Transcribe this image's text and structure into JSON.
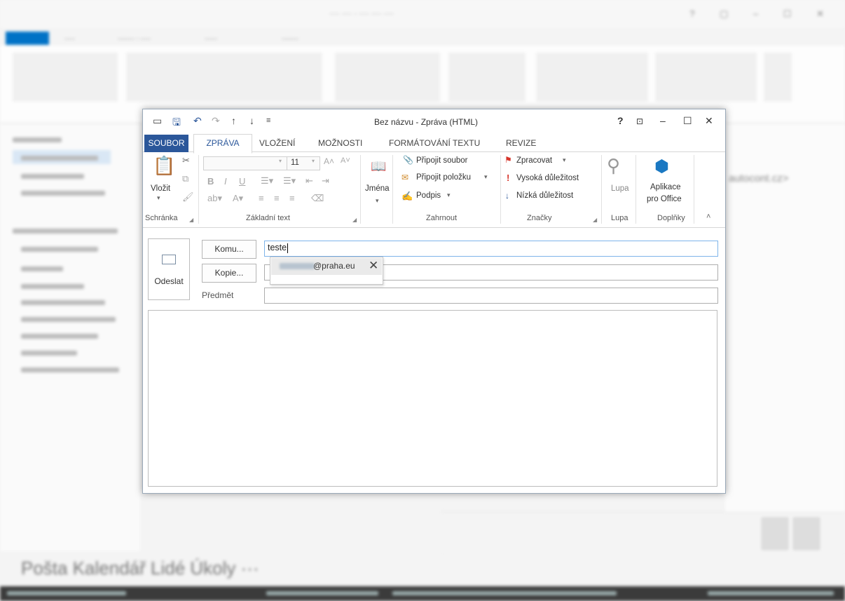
{
  "window": {
    "title": "Bez názvu - Zpráva (HTML)",
    "help": "?",
    "controls": [
      "–",
      "☐",
      "✕"
    ]
  },
  "menu": {
    "file": "SOUBOR",
    "tabs": [
      "ZPRÁVA",
      "VLOŽENÍ",
      "MOŽNOSTI",
      "FORMÁTOVÁNÍ TEXTU",
      "REVIZE"
    ],
    "active": "ZPRÁVA"
  },
  "ribbon": {
    "clipboard": {
      "paste": "Vložit",
      "label": "Schránka"
    },
    "basic_text": {
      "font_size": "11",
      "label": "Základní text"
    },
    "names": {
      "label": "Jména"
    },
    "include": {
      "attach_file": "Připojit soubor",
      "attach_item": "Připojit položku",
      "signature": "Podpis",
      "label": "Zahrnout"
    },
    "tags": {
      "follow_up": "Zpracovat",
      "high": "Vysoká důležitost",
      "low": "Nízká důležitost",
      "label": "Značky"
    },
    "zoom": {
      "button": "Lupa",
      "label": "Lupa"
    },
    "addins": {
      "button_line1": "Aplikace",
      "button_line2": "pro Office",
      "label": "Doplňky"
    }
  },
  "compose": {
    "send": "Odeslat",
    "to_btn": "Komu...",
    "cc_btn": "Kopie...",
    "subject_label": "Předmět",
    "to_value": "teste",
    "autocomplete": {
      "email_suffix": "@praha.eu"
    }
  },
  "background": {
    "email_hint": "autocont.cz>",
    "nav": "Pošta  Kalendář  Lidé  Úkoly  ···"
  }
}
